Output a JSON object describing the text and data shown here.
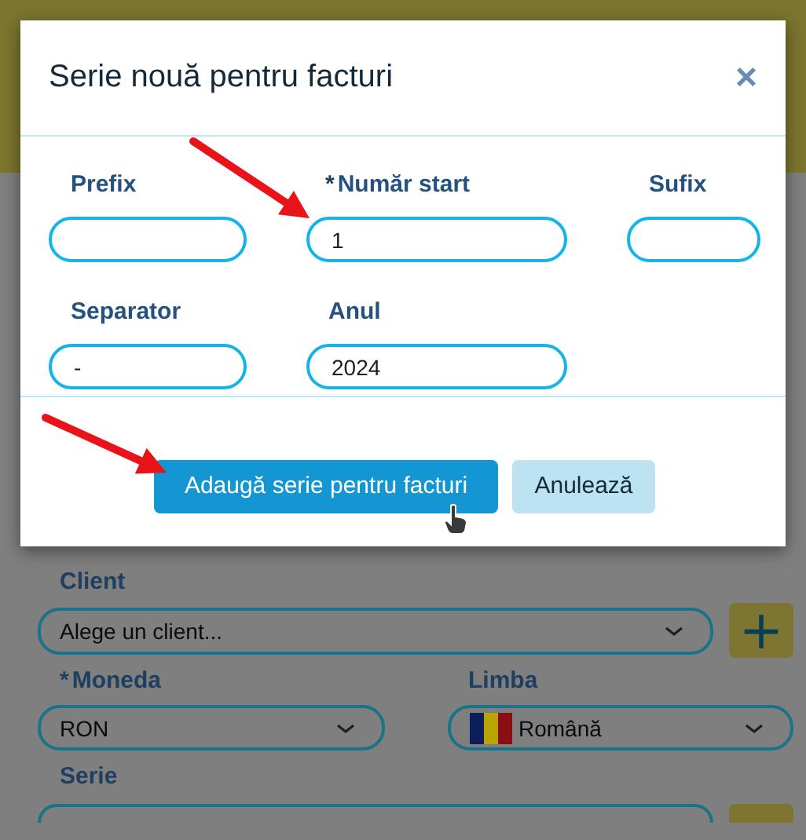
{
  "background_form": {
    "client": {
      "label": "Client",
      "placeholder": "Alege un client...",
      "add": "+"
    },
    "currency": {
      "required_mark": "*",
      "label": "Moneda",
      "value": "RON"
    },
    "language": {
      "label": "Limba",
      "value": "Română"
    },
    "series": {
      "label": "Serie"
    }
  },
  "dialog": {
    "title": "Serie nouă pentru facturi",
    "close": "×",
    "fields": [
      {
        "label": "Prefix"
      },
      {
        "label": "Număr start",
        "required_mark": "*",
        "value": "1"
      },
      {
        "label": "Sufix"
      },
      {
        "label": "Separator",
        "value": "-"
      },
      {
        "label": "Anul",
        "value": "2024"
      }
    ],
    "buttons": [
      {
        "kind": "primary",
        "label": "Adaugă serie pentru facturi"
      },
      {
        "kind": "secondary",
        "label": "Anulează"
      }
    ]
  }
}
